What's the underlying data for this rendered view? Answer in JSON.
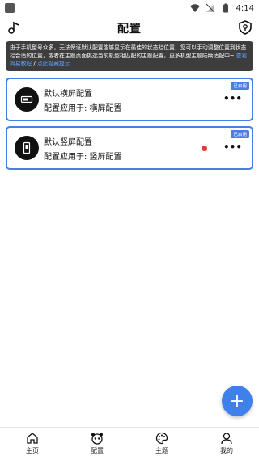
{
  "status_bar": {
    "time": "4:14"
  },
  "header": {
    "title": "配置"
  },
  "notice": {
    "text": "由于手机型号众多，无法保证默认配置能够显示在最佳的状态栏位置，您可以手动调整位置到状态栏合适的位置，或者在主题页面挑选当前机型相匹配的主题配置，更多机型主题陆续适配中~ ",
    "link_tutorial": "查看简易教程",
    "separator": " / ",
    "link_hide": "点此隐藏提示"
  },
  "configs": [
    {
      "title": "默认横屏配置",
      "subtitle": "配置应用于: 横屏配置",
      "badge": "已启用",
      "more": "•••"
    },
    {
      "title": "默认竖屏配置",
      "subtitle": "配置应用于: 竖屏配置",
      "badge": "已启用",
      "more": "•••"
    }
  ],
  "fab": {
    "label": "+"
  },
  "nav": [
    {
      "label": "主页",
      "icon": "home-icon"
    },
    {
      "label": "配置",
      "icon": "panda-icon"
    },
    {
      "label": "主题",
      "icon": "palette-icon"
    },
    {
      "label": "我的",
      "icon": "person-icon"
    }
  ],
  "colors": {
    "accent": "#4a7ee0",
    "notice_bg": "#3d3d3d",
    "link": "#5ea2ff",
    "dot": "#e53935"
  }
}
